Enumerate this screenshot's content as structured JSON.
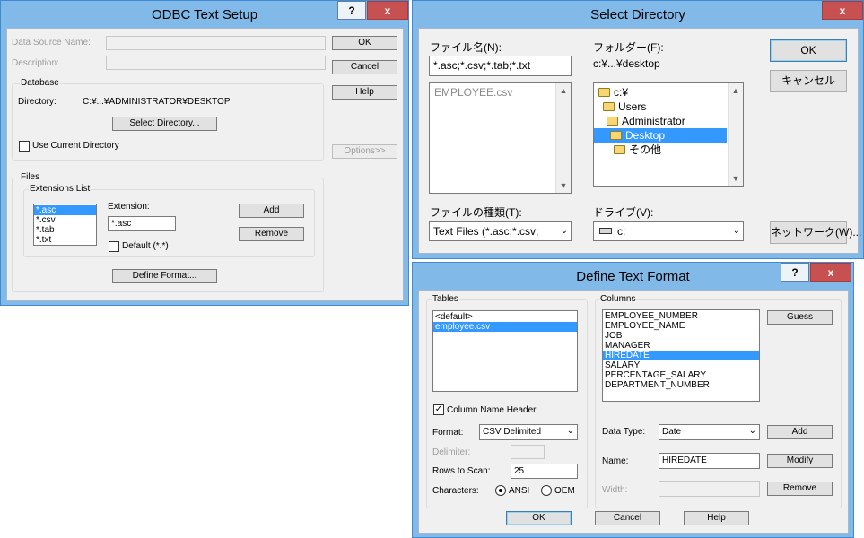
{
  "odbc": {
    "title": "ODBC Text Setup",
    "help_btn": "?",
    "close_btn": "x",
    "dsn_label": "Data Source Name:",
    "desc_label": "Description:",
    "ok": "OK",
    "cancel": "Cancel",
    "help": "Help",
    "options": "Options>>",
    "database_group": "Database",
    "directory_label": "Directory:",
    "directory_value": "C:¥...¥ADMINISTRATOR¥DESKTOP",
    "select_dir_btn": "Select Directory...",
    "use_current_label": "Use Current Directory",
    "files_group": "Files",
    "ext_group": "Extensions List",
    "extensions": [
      "*.asc",
      "*.csv",
      "*.tab",
      "*.txt"
    ],
    "extension_label": "Extension:",
    "extension_value": "*.asc",
    "add": "Add",
    "remove": "Remove",
    "default_label": "Default (*.*)",
    "define_format_btn": "Define Format..."
  },
  "select_dir": {
    "title": "Select Directory",
    "close_btn": "x",
    "filename_label": "ファイル名(N):",
    "filename_value": "*.asc;*.csv;*.tab;*.txt",
    "files": [
      "EMPLOYEE.csv"
    ],
    "folder_label": "フォルダー(F):",
    "folder_value": "c:¥...¥desktop",
    "tree": [
      "c:¥",
      "Users",
      "Administrator",
      "Desktop",
      "その他"
    ],
    "ok": "OK",
    "cancel": "キャンセル",
    "filetype_label": "ファイルの種類(T):",
    "filetype_value": "Text Files (*.asc;*.csv;",
    "drive_label": "ドライブ(V):",
    "drive_value": "c:",
    "network": "ネットワーク(W)..."
  },
  "define": {
    "title": "Define Text Format",
    "help_btn": "?",
    "close_btn": "x",
    "tables_group": "Tables",
    "tables": [
      "<default>",
      "employee.csv"
    ],
    "columns_group": "Columns",
    "columns": [
      "EMPLOYEE_NUMBER",
      "EMPLOYEE_NAME",
      "JOB",
      "MANAGER",
      "HIREDATE",
      "SALARY",
      "PERCENTAGE_SALARY",
      "DEPARTMENT_NUMBER"
    ],
    "guess": "Guess",
    "col_name_header": "Column Name Header",
    "format_label": "Format:",
    "format_value": "CSV Delimited",
    "delimiter_label": "Delimiter:",
    "rows_label": "Rows to Scan:",
    "rows_value": "25",
    "chars_label": "Characters:",
    "ansi": "ANSI",
    "oem": "OEM",
    "datatype_label": "Data Type:",
    "datatype_value": "Date",
    "name_label": "Name:",
    "name_value": "HIREDATE",
    "width_label": "Width:",
    "add": "Add",
    "modify": "Modify",
    "remove": "Remove",
    "ok": "OK",
    "cancel": "Cancel",
    "help": "Help"
  }
}
